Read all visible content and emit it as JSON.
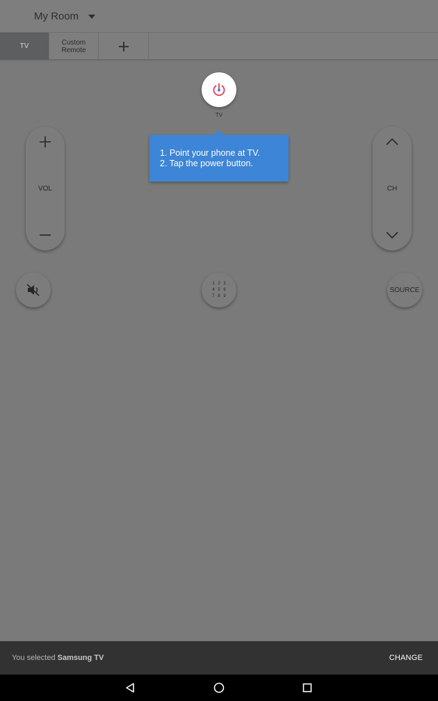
{
  "header": {
    "room_name": "My Room"
  },
  "tabs": [
    {
      "label": "TV",
      "active": true
    },
    {
      "label": "Custom\nRemote",
      "active": false
    },
    {
      "label": "+",
      "active": false
    }
  ],
  "remote": {
    "power_label": "TV",
    "tooltip_line1": "1. Point your phone at TV.",
    "tooltip_line2": "2. Tap the power button.",
    "volume_label": "VOL",
    "channel_label": "CH",
    "source_label": "SOURCE",
    "keypad_digits": [
      "1",
      "2",
      "3",
      "4",
      "5",
      "6",
      "7",
      "8",
      "9"
    ]
  },
  "snackbar": {
    "message_prefix": "You selected ",
    "device_name": "Samsung TV",
    "action_label": "CHANGE"
  },
  "colors": {
    "power_accent": "#e53950",
    "tooltip_bg": "#3d85d6",
    "active_tab_bg": "#5c5e5f"
  }
}
